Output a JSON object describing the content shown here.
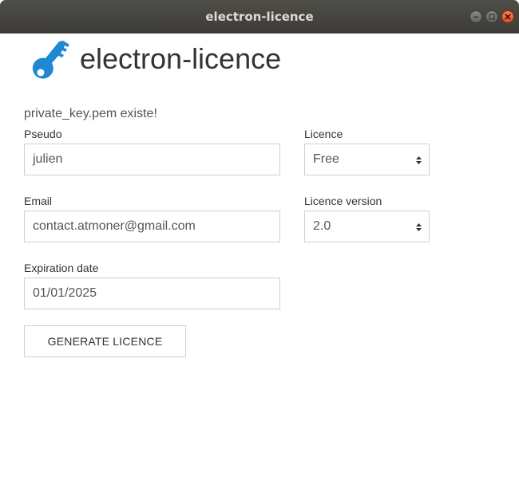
{
  "window": {
    "title": "electron-licence"
  },
  "header": {
    "icon": "key-icon",
    "icon_color": "#1e88d2",
    "title": "electron-licence"
  },
  "status_message": "private_key.pem existe!",
  "form": {
    "pseudo": {
      "label": "Pseudo",
      "value": "julien"
    },
    "email": {
      "label": "Email",
      "value": "contact.atmoner@gmail.com"
    },
    "expiration": {
      "label": "Expiration date",
      "value": "01/01/2025"
    },
    "licence": {
      "label": "Licence",
      "selected": "Free"
    },
    "licence_version": {
      "label": "Licence version",
      "selected": "2.0"
    },
    "generate_button": "GENERATE LICENCE"
  },
  "colors": {
    "titlebar": "#3c3b37",
    "close_button": "#e0502a",
    "border": "#cfcfcf"
  }
}
